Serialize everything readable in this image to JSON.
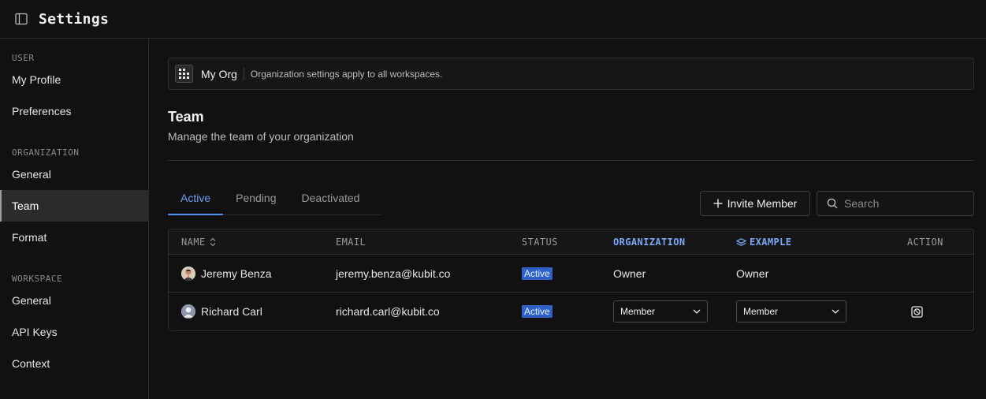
{
  "topbar": {
    "title": "Settings"
  },
  "sidebar": {
    "sections": [
      {
        "label": "USER",
        "items": [
          {
            "label": "My Profile"
          },
          {
            "label": "Preferences"
          }
        ]
      },
      {
        "label": "ORGANIZATION",
        "items": [
          {
            "label": "General"
          },
          {
            "label": "Team"
          },
          {
            "label": "Format"
          }
        ]
      },
      {
        "label": "WORKSPACE",
        "items": [
          {
            "label": "General"
          },
          {
            "label": "API Keys"
          },
          {
            "label": "Context"
          }
        ]
      }
    ],
    "active_item": "Team"
  },
  "org_bar": {
    "name": "My Org",
    "description": "Organization settings apply to all workspaces."
  },
  "page": {
    "title": "Team",
    "subtitle": "Manage the team of your organization"
  },
  "tabs": [
    {
      "label": "Active"
    },
    {
      "label": "Pending"
    },
    {
      "label": "Deactivated"
    }
  ],
  "active_tab": "Active",
  "toolbar": {
    "invite_label": "Invite Member",
    "search_placeholder": "Search"
  },
  "table": {
    "headers": {
      "name": "NAME",
      "email": "EMAIL",
      "status": "STATUS",
      "organization": "ORGANIZATION",
      "workspace": "EXAMPLE",
      "action": "ACTION"
    },
    "rows": [
      {
        "name": "Jeremy Benza",
        "email": "jeremy.benza@kubit.co",
        "status": "Active",
        "organization": "Owner",
        "workspace": "Owner"
      },
      {
        "name": "Richard Carl",
        "email": "richard.carl@kubit.co",
        "status": "Active",
        "organization": "Member",
        "workspace": "Member"
      }
    ]
  },
  "colors": {
    "accent": "#5b8def",
    "badge": "#2f62c9",
    "background": "#111111"
  },
  "icons": {
    "panel": "sidebar-toggle-icon",
    "org": "grid-icon",
    "plus": "plus-icon",
    "search": "search-icon",
    "sort": "sort-icon",
    "layers": "layers-icon",
    "chevron": "chevron-down-icon",
    "deactivate": "deactivate-user-icon"
  }
}
